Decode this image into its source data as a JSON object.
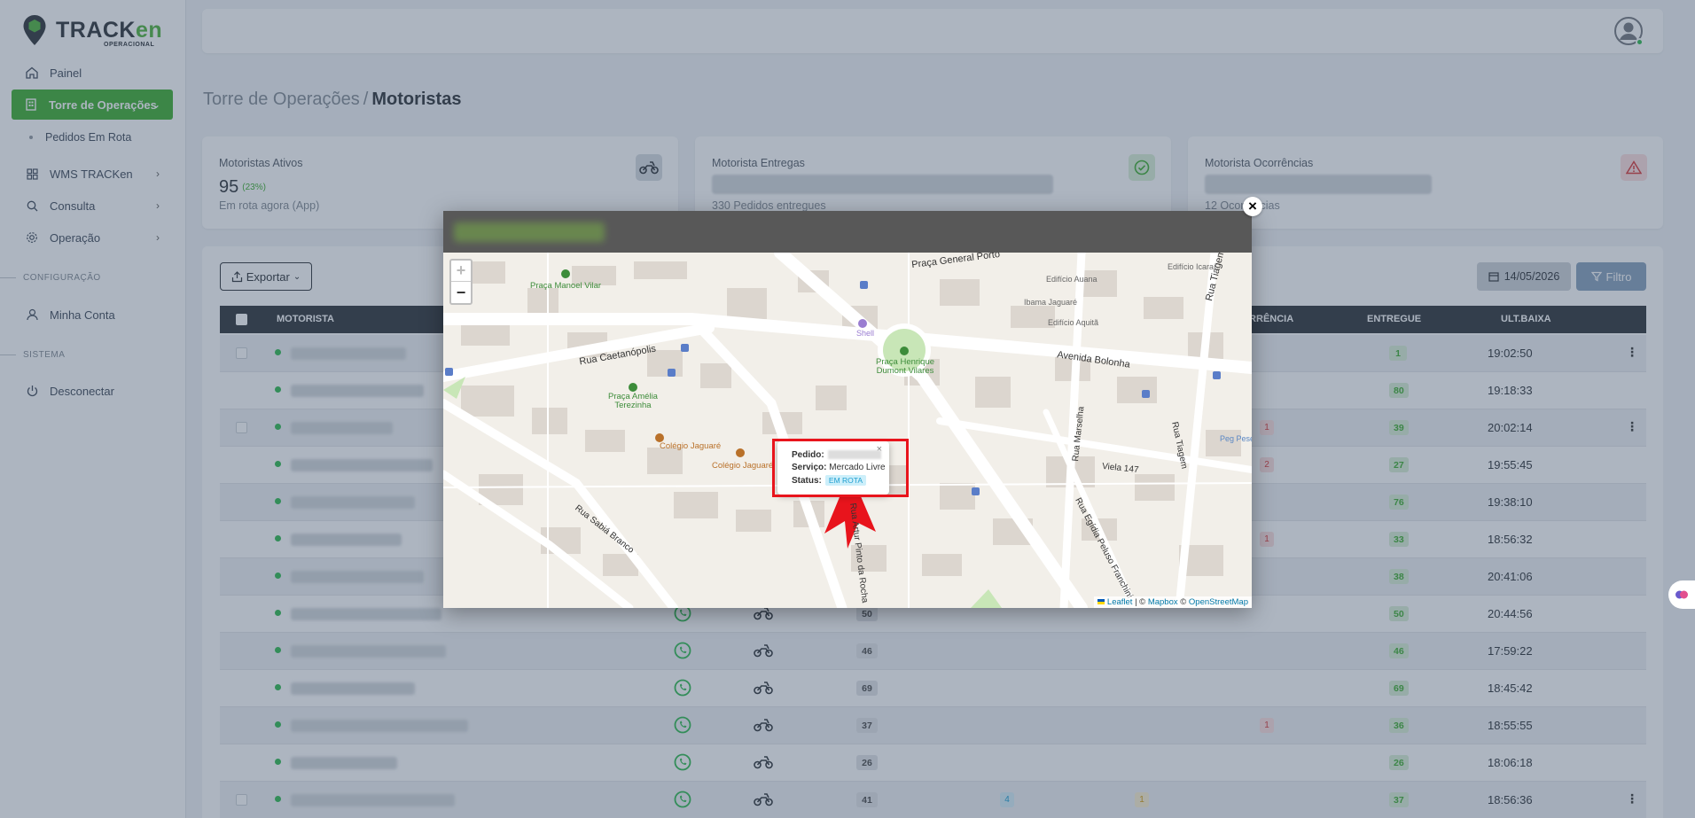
{
  "brand": {
    "name_a": "TRACK",
    "name_b": "en",
    "subtitle": "OPERACIONAL",
    "color": "#4ab33d"
  },
  "sidebar": {
    "items": [
      {
        "label": "Painel",
        "icon": "home-icon"
      },
      {
        "label": "Torre de Operações",
        "icon": "building-icon",
        "active": true
      },
      {
        "label": "WMS TRACKen",
        "icon": "grid-icon"
      },
      {
        "label": "Consulta",
        "icon": "search-icon"
      },
      {
        "label": "Operação",
        "icon": "gear-icon"
      },
      {
        "label": "Minha Conta",
        "icon": "user-icon"
      },
      {
        "label": "Desconectar",
        "icon": "power-icon"
      }
    ],
    "subitem": "Pedidos Em Rota",
    "section_config": "CONFIGURAÇÃO",
    "section_system": "SISTEMA"
  },
  "breadcrumb": {
    "parent": "Torre de Operações",
    "separator": "/",
    "current": "Motoristas"
  },
  "cards": [
    {
      "label": "Motoristas Ativos",
      "value": "95",
      "pct": "(23%)",
      "sub": "Em rota agora (App)",
      "icon": "motorcycle-icon"
    },
    {
      "label": "Motorista Entregas",
      "sub": "330 Pedidos entregues",
      "icon": "check-circle-icon"
    },
    {
      "label": "Motorista Ocorrências",
      "sub": "12 Ocorrências",
      "icon": "warning-icon"
    }
  ],
  "toolbar": {
    "export_label": "Exportar",
    "date": "14/05/2026",
    "filter_label": "Filtro"
  },
  "table": {
    "headers": {
      "driver": "MOTORISTA",
      "occurrence": "OCORRÊNCIA",
      "delivered": "ENTREGUE",
      "last": "ULT.BAIXA"
    },
    "rows": [
      {
        "total": "",
        "entregue": "1",
        "time": "19:02:50",
        "oc": "",
        "kebab": true,
        "cb": true
      },
      {
        "total": "",
        "entregue": "80",
        "time": "19:18:33",
        "oc": ""
      },
      {
        "total": "",
        "entregue": "39",
        "time": "20:02:14",
        "oc": "1",
        "kebab": true,
        "cb": true
      },
      {
        "total": "",
        "entregue": "27",
        "time": "19:55:45",
        "oc": "2"
      },
      {
        "total": "",
        "entregue": "76",
        "time": "19:38:10",
        "oc": ""
      },
      {
        "total": "",
        "entregue": "33",
        "time": "18:56:32",
        "oc": "1"
      },
      {
        "total": "",
        "entregue": "38",
        "time": "20:41:06",
        "oc": ""
      },
      {
        "total": "50",
        "entregue": "50",
        "time": "20:44:56",
        "oc": ""
      },
      {
        "total": "46",
        "entregue": "46",
        "time": "17:59:22",
        "oc": ""
      },
      {
        "total": "69",
        "entregue": "69",
        "time": "18:45:42",
        "oc": ""
      },
      {
        "total": "37",
        "entregue": "36",
        "time": "18:55:55",
        "oc": "1"
      },
      {
        "total": "26",
        "entregue": "26",
        "time": "18:06:18",
        "oc": ""
      },
      {
        "total": "41",
        "entregue": "37",
        "time": "18:56:36",
        "oc": "",
        "b4": "4",
        "b1": "1",
        "kebab": true,
        "cb": true
      }
    ]
  },
  "modal": {
    "close_label": "×",
    "zoom_in": "+",
    "zoom_out": "−",
    "attribution": {
      "leaflet": "Leaflet",
      "sep": "| ©",
      "mapbox": "Mapbox",
      "osm": "OpenStreetMap"
    },
    "popup": {
      "pedido_label": "Pedido:",
      "servico_label": "Serviço:",
      "servico_value": "Mercado Livre",
      "status_label": "Status:",
      "status_value": "EM ROTA",
      "close": "×"
    },
    "map_labels": {
      "praca_general_porto": "Praça General Porto",
      "praca_manoel_vilar": "Praça Manoel Vilar",
      "edificio_auana": "Edifício Auana",
      "edificio_icarai": "Edifício Icaraí",
      "ibama": "Ibama Jaguaré",
      "edificio_aquita": "Edifício Aquitã",
      "rua_tiagem_1": "Rua Tiagem",
      "shell": "Shell",
      "praca_henrique": "Praça Henrique\nDumont Vilares",
      "avenida_bolonha": "Avenida Bolonha",
      "rua_caetanopolis": "Rua Caetanópolis",
      "praca_amelia": "Praça Amélia\nTerezinha",
      "colegio_1": "Colégio Jaguaré",
      "colegio_2": "Colégio Jaguaré",
      "rua_marselha": "Rua Marselha",
      "rua_tiagem_2": "Rua Tiagem",
      "peg_pese": "Peg Pese",
      "viela": "Viela 147",
      "rua_egidia": "Rua Egídia Peluso Franchini",
      "rua_sabia": "Rua Sabiá Branco",
      "rua_artur": "Rua Artur Pinto da Rocha"
    }
  }
}
